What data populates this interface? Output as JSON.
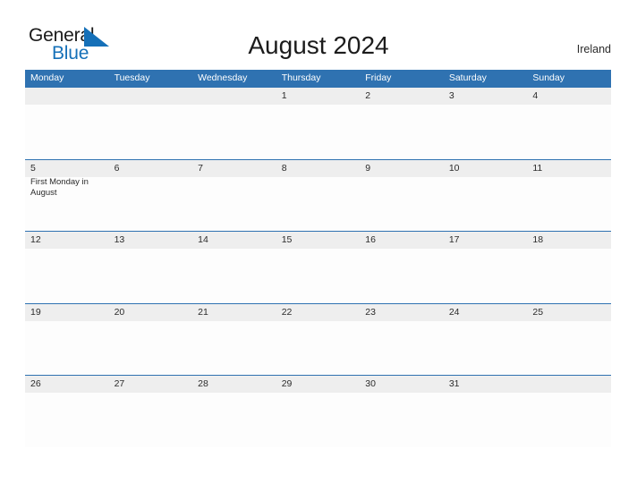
{
  "brand": {
    "name_part1": "General",
    "name_part2": "Blue",
    "triangle_icon": "triangle-logo-icon",
    "color_dark": "#1a1a1a",
    "color_blue": "#1570b8"
  },
  "header": {
    "title": "August 2024",
    "locale": "Ireland"
  },
  "colors": {
    "header_blue": "#2f72b1",
    "date_band_gray": "#eeeeee",
    "page_background": "#ffffff",
    "text_dark": "#2b2b2b"
  },
  "calendar": {
    "weekdays": [
      "Monday",
      "Tuesday",
      "Wednesday",
      "Thursday",
      "Friday",
      "Saturday",
      "Sunday"
    ],
    "weeks": [
      [
        {
          "date": "",
          "event": ""
        },
        {
          "date": "",
          "event": ""
        },
        {
          "date": "",
          "event": ""
        },
        {
          "date": "1",
          "event": ""
        },
        {
          "date": "2",
          "event": ""
        },
        {
          "date": "3",
          "event": ""
        },
        {
          "date": "4",
          "event": ""
        }
      ],
      [
        {
          "date": "5",
          "event": "First Monday in August"
        },
        {
          "date": "6",
          "event": ""
        },
        {
          "date": "7",
          "event": ""
        },
        {
          "date": "8",
          "event": ""
        },
        {
          "date": "9",
          "event": ""
        },
        {
          "date": "10",
          "event": ""
        },
        {
          "date": "11",
          "event": ""
        }
      ],
      [
        {
          "date": "12",
          "event": ""
        },
        {
          "date": "13",
          "event": ""
        },
        {
          "date": "14",
          "event": ""
        },
        {
          "date": "15",
          "event": ""
        },
        {
          "date": "16",
          "event": ""
        },
        {
          "date": "17",
          "event": ""
        },
        {
          "date": "18",
          "event": ""
        }
      ],
      [
        {
          "date": "19",
          "event": ""
        },
        {
          "date": "20",
          "event": ""
        },
        {
          "date": "21",
          "event": ""
        },
        {
          "date": "22",
          "event": ""
        },
        {
          "date": "23",
          "event": ""
        },
        {
          "date": "24",
          "event": ""
        },
        {
          "date": "25",
          "event": ""
        }
      ],
      [
        {
          "date": "26",
          "event": ""
        },
        {
          "date": "27",
          "event": ""
        },
        {
          "date": "28",
          "event": ""
        },
        {
          "date": "29",
          "event": ""
        },
        {
          "date": "30",
          "event": ""
        },
        {
          "date": "31",
          "event": ""
        },
        {
          "date": "",
          "event": ""
        }
      ]
    ]
  }
}
